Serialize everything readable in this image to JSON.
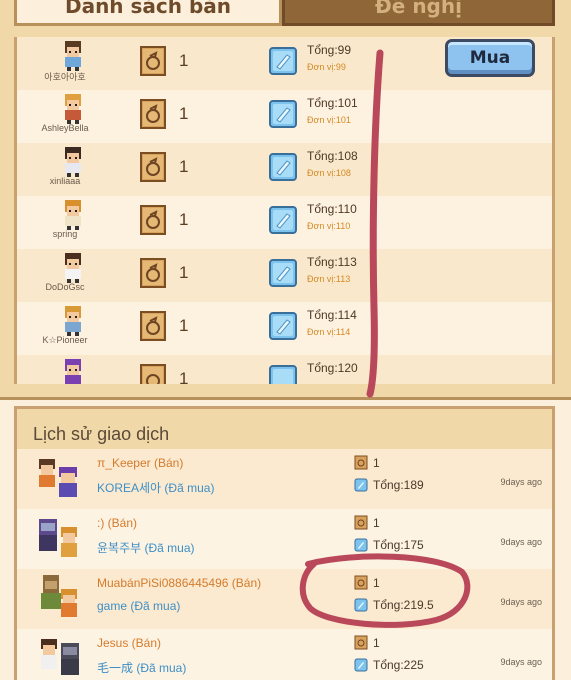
{
  "tabs": [
    {
      "label": "Danh sách bán"
    },
    {
      "label": "Đề nghị"
    }
  ],
  "buy_label": "Mua",
  "listings": [
    {
      "seller": "아호아아호",
      "qty": "1",
      "total": "Tổng:99",
      "unit": "Đơn vị:99"
    },
    {
      "seller": "AshleyBella",
      "qty": "1",
      "total": "Tổng:101",
      "unit": "Đơn vị:101"
    },
    {
      "seller": "xinliaaa",
      "qty": "1",
      "total": "Tổng:108",
      "unit": "Đơn vị:108"
    },
    {
      "seller": "spring",
      "qty": "1",
      "total": "Tổng:110",
      "unit": "Đơn vị:110"
    },
    {
      "seller": "DoDoGsc",
      "qty": "1",
      "total": "Tổng:113",
      "unit": "Đơn vị:113"
    },
    {
      "seller": "K☆Pioneer",
      "qty": "1",
      "total": "Tổng:114",
      "unit": "Đơn vị:114"
    },
    {
      "seller": "",
      "qty": "1",
      "total": "Tổng:120",
      "unit": ""
    }
  ],
  "history": {
    "title": "Lịch sử giao dịch",
    "items": [
      {
        "seller": "π_Keeper (Bán)",
        "buyer": "KOREA세아 (Đã mua)",
        "qty": "1",
        "total": "Tổng:189",
        "time": "9days ago"
      },
      {
        "seller": ":) (Bán)",
        "buyer": "윤복주부 (Đã mua)",
        "qty": "1",
        "total": "Tổng:175",
        "time": "9days ago"
      },
      {
        "seller": "MuabánPiSi0886445496 (Bán)",
        "buyer": "game (Đã mua)",
        "qty": "1",
        "total": "Tổng:219.5",
        "time": "9days ago"
      },
      {
        "seller": "Jesus (Bán)",
        "buyer": "毛一成 (Đã mua)",
        "qty": "1",
        "total": "Tổng:225",
        "time": "9days ago"
      }
    ]
  },
  "colors": {
    "panel": "#f0d8a9",
    "border": "#b89059",
    "seller_text": "#d47b2c",
    "buyer_text": "#3d8fc7",
    "unit_text": "#d58a24",
    "buy_button": "#8ec2ef",
    "annotation": "#b9485b"
  }
}
